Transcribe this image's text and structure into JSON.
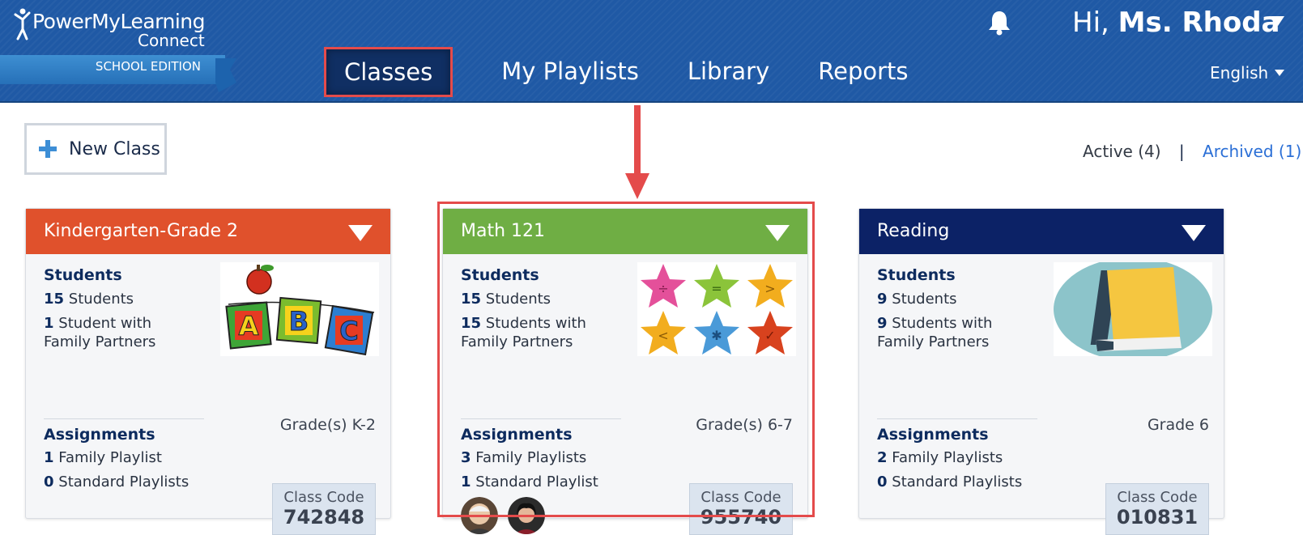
{
  "header": {
    "brand_name": "PowerMyLearning",
    "brand_sub": "Connect",
    "edition": "SCHOOL EDITION",
    "greeting_prefix": "Hi,",
    "user_name": "Ms. Rhoda",
    "language": "English",
    "nav": [
      {
        "label": "Classes",
        "active": true
      },
      {
        "label": "My Playlists",
        "active": false
      },
      {
        "label": "Library",
        "active": false
      },
      {
        "label": "Reports",
        "active": false
      }
    ]
  },
  "toolbar": {
    "new_class_label": "New Class",
    "filter_active": "Active (4)",
    "filter_separator": "|",
    "filter_archived": "Archived (1)"
  },
  "colors": {
    "header_bg": "#1f59a5",
    "highlight": "#e44b4b",
    "card1_head": "#e0512c",
    "card2_head": "#6fae44",
    "card3_head": "#0c2266"
  },
  "cards": [
    {
      "title": "Kindergarten-Grade 2",
      "image_icon": "abc-blocks-apple-image",
      "students_title": "Students",
      "students_count": "15",
      "students_suffix": "Students",
      "family_count": "1",
      "family_line1": "Student with",
      "family_line2": "Family Partners",
      "grade": "Grade(s) K-2",
      "assignments_title": "Assignments",
      "family_playlists_count": "1",
      "family_playlists_label": "Family Playlist",
      "standard_playlists_count": "0",
      "standard_playlists_label": "Standard Playlists",
      "code_label": "Class Code",
      "code_value": "742848"
    },
    {
      "title": "Math 121",
      "image_icon": "math-stars-image",
      "students_title": "Students",
      "students_count": "15",
      "students_suffix": "Students",
      "family_count": "15",
      "family_line1": "Students with",
      "family_line2": "Family Partners",
      "grade": "Grade(s) 6-7",
      "assignments_title": "Assignments",
      "family_playlists_count": "3",
      "family_playlists_label": "Family Playlists",
      "standard_playlists_count": "1",
      "standard_playlists_label": "Standard Playlist",
      "code_label": "Class Code",
      "code_value": "955740"
    },
    {
      "title": "Reading",
      "image_icon": "book-image",
      "students_title": "Students",
      "students_count": "9",
      "students_suffix": "Students",
      "family_count": "9",
      "family_line1": "Students with",
      "family_line2": "Family Partners",
      "grade": "Grade 6",
      "assignments_title": "Assignments",
      "family_playlists_count": "2",
      "family_playlists_label": "Family Playlists",
      "standard_playlists_count": "0",
      "standard_playlists_label": "Standard Playlists",
      "code_label": "Class Code",
      "code_value": "010831"
    }
  ]
}
